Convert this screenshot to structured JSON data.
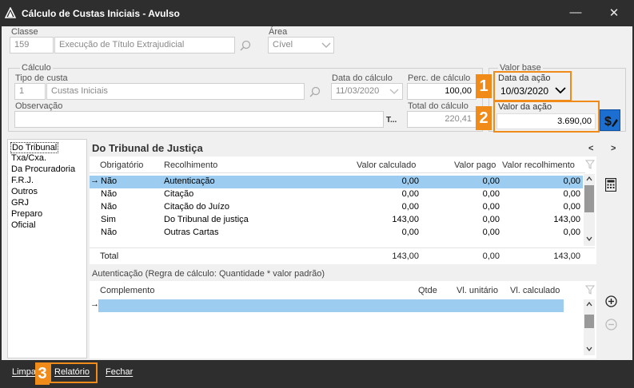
{
  "window": {
    "title": "Cálculo de Custas Iniciais - Avulso",
    "minimize_glyph": "—",
    "close_glyph": "✕"
  },
  "header": {
    "classe_label": "Classe",
    "classe_code": "159",
    "classe_name": "Execução de Título Extrajudicial",
    "area_label": "Área",
    "area_value": "Cível"
  },
  "calculo": {
    "group_label": "Cálculo",
    "tipo_label": "Tipo de custa",
    "tipo_code": "1",
    "tipo_name": "Custas Iniciais",
    "data_label": "Data do cálculo",
    "data_value": "11/03/2020",
    "perc_label": "Perc. de cálculo",
    "perc_value": "100,00",
    "obs_label": "Observação",
    "obs_button": "T...",
    "total_label": "Total do cálculo",
    "total_value": "220,41"
  },
  "valor_base": {
    "group_label": "Valor base",
    "data_acao_label": "Data da ação",
    "data_acao_value": "10/03/2020",
    "valor_acao_label": "Valor da ação",
    "valor_acao_value": "3.690,00"
  },
  "badges": {
    "b1": "1",
    "b2": "2",
    "b3": "3"
  },
  "sidebar": {
    "items": [
      "Do Tribunal",
      "Txa/Cxa.",
      "Da Procuradoria",
      "F.R.J.",
      "Outros",
      "GRJ",
      "Preparo",
      "Oficial"
    ]
  },
  "panel": {
    "title": "Do Tribunal de Justiça",
    "prev": "<",
    "next": ">",
    "columns": [
      "Obrigatório",
      "Recolhimento",
      "Valor calculado",
      "Valor pago",
      "Valor recolhimento"
    ],
    "rows": [
      {
        "obrig": "Não",
        "recol": "Autenticação",
        "calc": "0,00",
        "pago": "0,00",
        "recv": "0,00"
      },
      {
        "obrig": "Não",
        "recol": "Citação",
        "calc": "0,00",
        "pago": "0,00",
        "recv": "0,00"
      },
      {
        "obrig": "Não",
        "recol": "Citação do Juízo",
        "calc": "0,00",
        "pago": "0,00",
        "recv": "0,00"
      },
      {
        "obrig": "Sim",
        "recol": "Do Tribunal de justiça",
        "calc": "143,00",
        "pago": "0,00",
        "recv": "143,00"
      },
      {
        "obrig": "Não",
        "recol": "Outras Cartas",
        "calc": "0,00",
        "pago": "0,00",
        "recv": "0,00"
      }
    ],
    "total_label": "Total",
    "total_calc": "143,00",
    "total_pago": "0,00",
    "total_recv": "143,00"
  },
  "detail": {
    "caption": "Autenticação (Regra de cálculo: Quantidade * valor padrão)",
    "columns": [
      "Complemento",
      "Qtde",
      "Vl. unitário",
      "Vl. calculado"
    ]
  },
  "footer": {
    "limpar": "Limpar",
    "relatorio": "Relatório",
    "fechar": "Fechar"
  },
  "colors": {
    "orange": "#f08a18",
    "selection": "#9cccef",
    "accent_blue": "#1c6ed1",
    "bar": "#2e2e2e"
  }
}
